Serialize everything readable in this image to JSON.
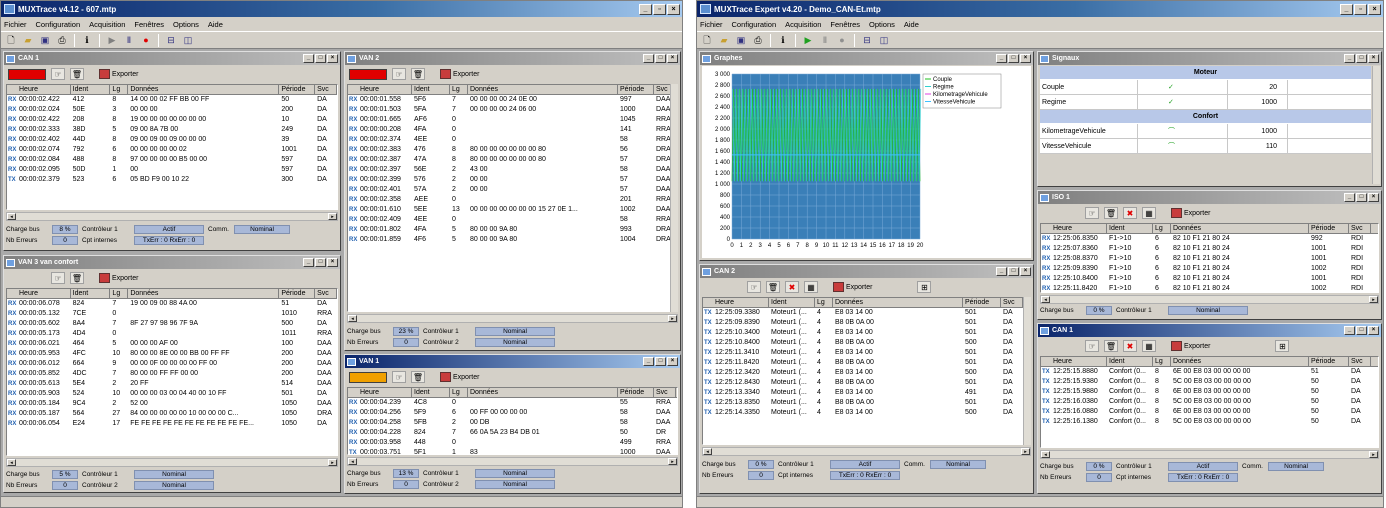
{
  "colors": {
    "title_active": "#0a246a",
    "title_inactive": "#808080",
    "status_value": "#a8b8d8",
    "red": "#e00000",
    "orange": "#f0a000"
  },
  "menu": [
    "Fichier",
    "Configuration",
    "Acquisition",
    "Fenêtres",
    "Options",
    "Aide"
  ],
  "toolbar_icons": [
    "new-icon",
    "open-icon",
    "save-icon",
    "print-icon",
    "info-icon",
    "play-icon",
    "pause-icon",
    "record-icon",
    "tile-horizontal-icon",
    "tile-vertical-icon"
  ],
  "left": {
    "title": "MUXTrace v4.12 - 607.mtp",
    "can1": {
      "title": "CAN 1",
      "export": "Exporter",
      "cols": [
        "Heure",
        "Ident",
        "Lg",
        "Données",
        "Période",
        "Svc"
      ],
      "rows": [
        [
          "RX",
          "00:00:02.422",
          "412",
          "8",
          "14 00 00 02 FF BB 00 FF",
          "50",
          "DA"
        ],
        [
          "RX",
          "00:00:02.024",
          "50E",
          "3",
          "00 00 00",
          "200",
          "DA"
        ],
        [
          "RX",
          "00:00:02.422",
          "208",
          "8",
          "19 00 00 00 00 00 00 00",
          "10",
          "DA"
        ],
        [
          "RX",
          "00:00:02.333",
          "38D",
          "5",
          "09 00 8A 7B 00",
          "249",
          "DA"
        ],
        [
          "RX",
          "00:00:02.402",
          "44D",
          "8",
          "09 00 09 00 09 00 00 00",
          "39",
          "DA"
        ],
        [
          "RX",
          "00:00:02.074",
          "792",
          "6",
          "00 00 00 00 00 02",
          "1001",
          "DA"
        ],
        [
          "RX",
          "00:00:02.084",
          "488",
          "8",
          "97 00 00 00 00 B5 00 00",
          "597",
          "DA"
        ],
        [
          "RX",
          "00:00:02.095",
          "50D",
          "1",
          "00",
          "597",
          "DA"
        ],
        [
          "TX",
          "00:00:02.379",
          "523",
          "6",
          "05 BD F9 00 10 22",
          "300",
          "DA"
        ]
      ],
      "stat": {
        "bus_label": "Charge bus",
        "bus_val": "8 %",
        "ctrl_label": "Contrôleur 1",
        "ctrl_val": "Actif",
        "comm_label": "Comm.",
        "comm_val": "Nominal",
        "err_label": "Nb Erreurs",
        "err_val": "0",
        "cpt_label": "Cpt internes",
        "cpt_val": "TxErr : 0 RxErr : 0"
      }
    },
    "van3": {
      "title": "VAN 3 van confort",
      "export": "Exporter",
      "cols": [
        "Heure",
        "Ident",
        "Lg",
        "Données",
        "Période",
        "Svc"
      ],
      "rows": [
        [
          "RX",
          "00:00:06.078",
          "824",
          "7",
          "19 00 09 00 88 4A 00",
          "51",
          "DA"
        ],
        [
          "RX",
          "00:00:05.132",
          "7CE",
          "0",
          "",
          "1010",
          "RRA"
        ],
        [
          "RX",
          "00:00:05.602",
          "8A4",
          "7",
          "8F 27 97 98 96 7F 9A",
          "500",
          "DA"
        ],
        [
          "RX",
          "00:00:05.173",
          "4D4",
          "0",
          "",
          "1011",
          "RRA"
        ],
        [
          "RX",
          "00:00:06.021",
          "464",
          "5",
          "00 00 00 AF 00",
          "100",
          "DAA"
        ],
        [
          "RX",
          "00:00:05.953",
          "4FC",
          "10",
          "80 00 00 8E 00 00 BB 00 FF FF",
          "200",
          "DAA"
        ],
        [
          "RX",
          "00:00:06.012",
          "664",
          "9",
          "00 00 0F 00 00 00 00 FF 00",
          "200",
          "DAA"
        ],
        [
          "RX",
          "00:00:05.852",
          "4DC",
          "7",
          "80 00 00 FF FF 00 00",
          "200",
          "DAA"
        ],
        [
          "RX",
          "00:00:05.613",
          "5E4",
          "2",
          "20 FF",
          "514",
          "DAA"
        ],
        [
          "RX",
          "00:00:05.903",
          "524",
          "10",
          "00 00 00 03 00 04 40 00 10 FF",
          "501",
          "DA"
        ],
        [
          "RX",
          "00:00:05.184",
          "9C4",
          "2",
          "52 00",
          "1050",
          "DAA"
        ],
        [
          "RX",
          "00:00:05.187",
          "564",
          "27",
          "84 00 00 00 00 00 10 00 00 00 C...",
          "1050",
          "DRA"
        ],
        [
          "RX",
          "00:00:06.054",
          "E24",
          "17",
          "FE FE FE FE FE FE FE FE FE FE FE...",
          "1050",
          "DA"
        ]
      ],
      "stat": {
        "bus_label": "Charge bus",
        "bus_val": "5 %",
        "ctrl_label": "Contrôleur 1",
        "ctrl_val": "Nominal",
        "err_label": "Nb Erreurs",
        "err_val": "0",
        "ctrl2_label": "Contrôleur 2",
        "ctrl2_val": "Nominal"
      }
    },
    "van2": {
      "title": "VAN 2",
      "export": "Exporter",
      "cols": [
        "Heure",
        "Ident",
        "Lg",
        "Données",
        "Période",
        "Svc"
      ],
      "rows": [
        [
          "RX",
          "00:00:01.558",
          "5F6",
          "7",
          "00 00 00 00 24 0E 00",
          "997",
          "DAA"
        ],
        [
          "RX",
          "00:00:01.503",
          "5FA",
          "7",
          "00 00 00 00 24 06 00",
          "1000",
          "DAA"
        ],
        [
          "RX",
          "00:00:01.665",
          "AF6",
          "0",
          "",
          "1045",
          "RRA"
        ],
        [
          "RX",
          "00:00:00.208",
          "4FA",
          "0",
          "",
          "141",
          "RRA"
        ],
        [
          "RX",
          "00:00:02.374",
          "4EE",
          "0",
          "",
          "58",
          "RRA"
        ],
        [
          "RX",
          "00:00:02.383",
          "476",
          "8",
          "80 00 00 00 00 00 00 80",
          "56",
          "DRA"
        ],
        [
          "RX",
          "00:00:02.387",
          "47A",
          "8",
          "80 00 00 00 00 00 00 80",
          "57",
          "DRA"
        ],
        [
          "RX",
          "00:00:02.397",
          "56E",
          "2",
          "43 00",
          "58",
          "DAA"
        ],
        [
          "RX",
          "00:00:02.399",
          "576",
          "2",
          "00 00",
          "57",
          "DAA"
        ],
        [
          "RX",
          "00:00:02.401",
          "57A",
          "2",
          "00 00",
          "57",
          "DAA"
        ],
        [
          "RX",
          "00:00:02.358",
          "AEE",
          "0",
          "",
          "201",
          "RRA"
        ],
        [
          "RX",
          "00:00:01.610",
          "5EE",
          "13",
          "00 00 00 00 00 00 00 15 27 0E 1...",
          "1002",
          "DAA"
        ],
        [
          "RX",
          "00:00:02.409",
          "4EE",
          "0",
          "",
          "58",
          "RRA"
        ],
        [
          "RX",
          "00:00:01.802",
          "4FA",
          "5",
          "80 00 00 9A 80",
          "993",
          "DRA"
        ],
        [
          "RX",
          "00:00:01.859",
          "4F6",
          "5",
          "80 00 00 9A 80",
          "1004",
          "DRA"
        ]
      ],
      "stat": {
        "bus_label": "Charge bus",
        "bus_val": "23 %",
        "ctrl_label": "Contrôleur 1",
        "ctrl_val": "Nominal",
        "err_label": "Nb Erreurs",
        "err_val": "0",
        "ctrl2_label": "Contrôleur 2",
        "ctrl2_val": "Nominal"
      }
    },
    "van1": {
      "title": "VAN 1",
      "export": "Exporter",
      "cols": [
        "Heure",
        "Ident",
        "Lg",
        "Données",
        "Période",
        "Svc"
      ],
      "rows": [
        [
          "RX",
          "00:00:04.239",
          "4C8",
          "0",
          "",
          "55",
          "RRA"
        ],
        [
          "RX",
          "00:00:04.256",
          "5F9",
          "6",
          "00 FF 00 00 00 00",
          "58",
          "DAA"
        ],
        [
          "RX",
          "00:00:04.258",
          "5FB",
          "2",
          "00 DB",
          "58",
          "DAA"
        ],
        [
          "RX",
          "00:00:04.228",
          "824",
          "7",
          "66 0A 5A 23 B4 DB 01",
          "50",
          "DR"
        ],
        [
          "RX",
          "00:00:03.958",
          "448",
          "0",
          "",
          "499",
          "RRA"
        ],
        [
          "TX",
          "00:00:03.751",
          "5F1",
          "1",
          "83",
          "1000",
          "DAA"
        ]
      ],
      "stat": {
        "bus_label": "Charge bus",
        "bus_val": "13 %",
        "ctrl_label": "Contrôleur 1",
        "ctrl_val": "Nominal",
        "err_label": "Nb Erreurs",
        "err_val": "0",
        "ctrl2_label": "Contrôleur 2",
        "ctrl2_val": "Nominal"
      }
    }
  },
  "right": {
    "title": "MUXTrace Expert v4.20 - Demo_CAN-Et.mtp",
    "graphes": {
      "title": "Graphes",
      "legend": [
        "Couple",
        "Regime",
        "KilometrageVehicule",
        "VitesseVehicule"
      ],
      "legend_colors": [
        "#20c020",
        "#30d0d0",
        "#e040e0",
        "#40c0ff"
      ],
      "y_ticks": [
        "3 000",
        "2 800",
        "2 600",
        "2 400",
        "2 200",
        "2 000",
        "1 800",
        "1 600",
        "1 400",
        "1 200",
        "1 000",
        "800",
        "600",
        "400",
        "200",
        "0"
      ],
      "x_ticks": [
        "0",
        "1",
        "2",
        "3",
        "4",
        "5",
        "6",
        "7",
        "8",
        "9",
        "10",
        "11",
        "12",
        "13",
        "14",
        "15",
        "16",
        "17",
        "18",
        "19",
        "20"
      ]
    },
    "signaux": {
      "title": "Signaux",
      "groups": [
        {
          "name": "Moteur",
          "rows": [
            [
              "Couple",
              "20"
            ],
            [
              "Regime",
              "1000"
            ]
          ]
        },
        {
          "name": "Confort",
          "rows": [
            [
              "KilometrageVehicule",
              "1000"
            ],
            [
              "VitesseVehicule",
              "110"
            ]
          ]
        }
      ]
    },
    "iso1": {
      "title": "ISO 1",
      "export": "Exporter",
      "cols": [
        "Heure",
        "Ident",
        "Lg",
        "Données",
        "Période",
        "Svc"
      ],
      "rows": [
        [
          "RX",
          "12:25:06.8350",
          "F1->10",
          "6",
          "82 10 F1 21 80 24",
          "992",
          "RDI"
        ],
        [
          "RX",
          "12:25:07.8360",
          "F1->10",
          "6",
          "82 10 F1 21 80 24",
          "1001",
          "RDI"
        ],
        [
          "RX",
          "12:25:08.8370",
          "F1->10",
          "6",
          "82 10 F1 21 80 24",
          "1001",
          "RDI"
        ],
        [
          "RX",
          "12:25:09.8390",
          "F1->10",
          "6",
          "82 10 F1 21 80 24",
          "1002",
          "RDI"
        ],
        [
          "RX",
          "12:25:10.8400",
          "F1->10",
          "6",
          "82 10 F1 21 80 24",
          "1001",
          "RDI"
        ],
        [
          "RX",
          "12:25:11.8420",
          "F1->10",
          "6",
          "82 10 F1 21 80 24",
          "1002",
          "RDI"
        ]
      ],
      "stat": {
        "bus_label": "Charge bus",
        "bus_val": "0 %",
        "ctrl_label": "Contrôleur 1",
        "ctrl_val": "Nominal",
        "err_label": "Nb Erreurs",
        "err_val": "0"
      }
    },
    "can2": {
      "title": "CAN 2",
      "export": "Exporter",
      "cols": [
        "Heure",
        "Ident",
        "Lg",
        "Données",
        "Période",
        "Svc"
      ],
      "rows": [
        [
          "TX",
          "12:25:09.3380",
          "Moteur1 (...",
          "4",
          "E8 03 14 00",
          "501",
          "DA"
        ],
        [
          "TX",
          "12:25:09.8390",
          "Moteur1 (...",
          "4",
          "B8 0B 0A 00",
          "501",
          "DA"
        ],
        [
          "TX",
          "12:25:10.3400",
          "Moteur1 (...",
          "4",
          "E8 03 14 00",
          "501",
          "DA"
        ],
        [
          "TX",
          "12:25:10.8400",
          "Moteur1 (...",
          "4",
          "B8 0B 0A 00",
          "500",
          "DA"
        ],
        [
          "TX",
          "12:25:11.3410",
          "Moteur1 (...",
          "4",
          "E8 03 14 00",
          "501",
          "DA"
        ],
        [
          "TX",
          "12:25:11.8420",
          "Moteur1 (...",
          "4",
          "B8 0B 0A 00",
          "501",
          "DA"
        ],
        [
          "TX",
          "12:25:12.3420",
          "Moteur1 (...",
          "4",
          "E8 03 14 00",
          "500",
          "DA"
        ],
        [
          "TX",
          "12:25:12.8430",
          "Moteur1 (...",
          "4",
          "B8 0B 0A 00",
          "501",
          "DA"
        ],
        [
          "TX",
          "12:25:13.3340",
          "Moteur1 (...",
          "4",
          "E8 03 14 00",
          "491",
          "DA"
        ],
        [
          "TX",
          "12:25:13.8350",
          "Moteur1 (...",
          "4",
          "B8 0B 0A 00",
          "501",
          "DA"
        ],
        [
          "TX",
          "12:25:14.3350",
          "Moteur1 (...",
          "4",
          "E8 03 14 00",
          "500",
          "DA"
        ]
      ],
      "stat": {
        "bus_label": "Charge bus",
        "bus_val": "0 %",
        "ctrl_label": "Contrôleur 1",
        "ctrl_val": "Actif",
        "comm_label": "Comm.",
        "comm_val": "Nominal",
        "err_label": "Nb Erreurs",
        "err_val": "0",
        "cpt_label": "Cpt internes",
        "cpt_val": "TxErr : 0 RxErr : 0"
      }
    },
    "can1": {
      "title": "CAN 1",
      "export": "Exporter",
      "cols": [
        "Heure",
        "Ident",
        "Lg",
        "Données",
        "Période",
        "Svc"
      ],
      "rows": [
        [
          "TX",
          "12:25:15.8880",
          "Confort (0...",
          "8",
          "6E 00 E8 03 00 00 00 00",
          "51",
          "DA"
        ],
        [
          "TX",
          "12:25:15.9380",
          "Confort (0...",
          "8",
          "5C 00 E8 03 00 00 00 00",
          "50",
          "DA"
        ],
        [
          "TX",
          "12:25:15.9880",
          "Confort (0...",
          "8",
          "6E 00 E8 03 00 00 00 00",
          "50",
          "DA"
        ],
        [
          "TX",
          "12:25:16.0380",
          "Confort (0...",
          "8",
          "5C 00 E8 03 00 00 00 00",
          "50",
          "DA"
        ],
        [
          "TX",
          "12:25:16.0880",
          "Confort (0...",
          "8",
          "6E 00 E8 03 00 00 00 00",
          "50",
          "DA"
        ],
        [
          "TX",
          "12:25:16.1380",
          "Confort (0...",
          "8",
          "5C 00 E8 03 00 00 00 00",
          "50",
          "DA"
        ]
      ],
      "stat": {
        "bus_label": "Charge bus",
        "bus_val": "0 %",
        "ctrl_label": "Contrôleur 1",
        "ctrl_val": "Actif",
        "comm_label": "Comm.",
        "comm_val": "Nominal",
        "err_label": "Nb Erreurs",
        "err_val": "0",
        "cpt_label": "Cpt internes",
        "cpt_val": "TxErr : 0 RxErr : 0"
      }
    }
  }
}
